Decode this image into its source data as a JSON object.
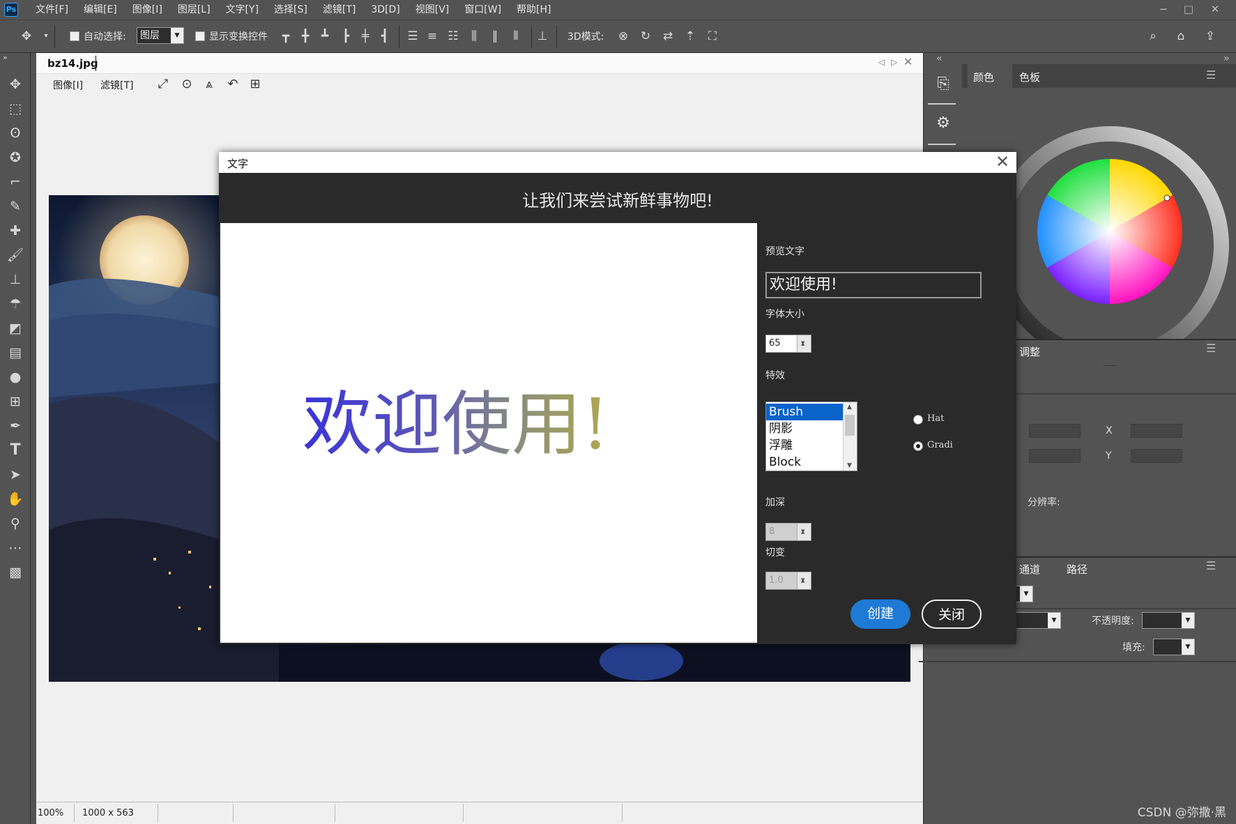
{
  "app": {
    "logo": "Ps"
  },
  "menubar": {
    "items": [
      "文件[F]",
      "编辑[E]",
      "图像[I]",
      "图层[L]",
      "文字[Y]",
      "选择[S]",
      "滤镜[T]",
      "3D[D]",
      "视图[V]",
      "窗口[W]",
      "帮助[H]"
    ]
  },
  "window_controls": {
    "minimize": "−",
    "maximize": "□",
    "close": "✕"
  },
  "options_bar": {
    "auto_select_label": "自动选择:",
    "auto_select_value": "图层",
    "show_transform_label": "显示变换控件",
    "mode_3d_label": "3D模式:"
  },
  "document": {
    "tab_name": "bz14.jpg",
    "menu": [
      "图像[I]",
      "滤镜[T]"
    ],
    "status": {
      "zoom": "100%",
      "size": "1000 x 563"
    }
  },
  "right_panel": {
    "tabs_top": [
      "颜色",
      "色板"
    ],
    "adjust_tab": "调整",
    "x_label": "X",
    "y_label": "Y",
    "resolution_label": "分辨率:",
    "tabs_bottom": [
      "通道",
      "路径"
    ],
    "opacity_label": "不透明度:",
    "fill_label": "填充:"
  },
  "dialog": {
    "title": "文字",
    "header": "让我们来尝试新鲜事物吧!",
    "preview_text": "欢迎使用!",
    "preview_label": "预览文字",
    "preview_input": "欢迎使用!",
    "font_size_label": "字体大小",
    "font_size_value": "65",
    "effects_label": "特效",
    "effects": [
      "Brush",
      "阴影",
      "浮雕",
      "Block"
    ],
    "selected_effect": "Brush",
    "radio_options": [
      "Hat",
      "Gradi"
    ],
    "selected_radio": "Gradi",
    "deepen_label": "加深",
    "deepen_value": "8",
    "gradient_label": "切变",
    "gradient_value": "1.0",
    "create_button": "创建",
    "close_button": "关闭"
  },
  "watermark": "CSDN @弥撒·黑",
  "colors": {
    "accent": "#1e7ad4",
    "background": "#535353",
    "dialog_bg": "#2a2a2a"
  }
}
